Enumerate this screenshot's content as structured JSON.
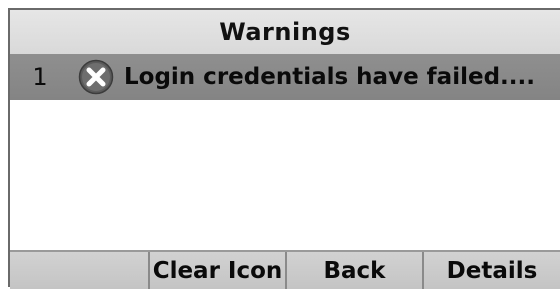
{
  "title": "Warnings",
  "warnings": [
    {
      "index": "1",
      "icon": "error-x-icon",
      "text": "Login credentials have failed...."
    }
  ],
  "softkeys": [
    "",
    "Clear Icon",
    "Back",
    "Details"
  ],
  "colors": {
    "title_bar": "#dcdcdc",
    "selected_row": "#8a8a8a",
    "softkey_bar": "#c8c8c8",
    "background": "#ffffff"
  }
}
